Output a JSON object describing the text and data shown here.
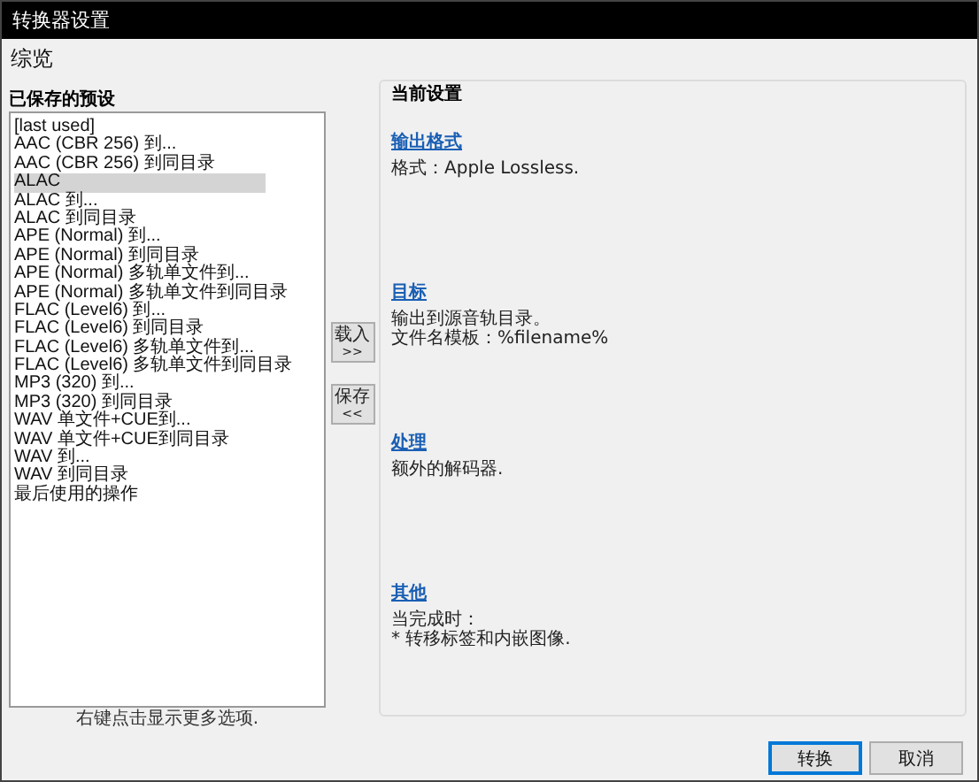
{
  "window": {
    "title": "转换器设置"
  },
  "heading": "综览",
  "presets": {
    "label": "已保存的预设",
    "hint": "右键点击显示更多选项.",
    "items": [
      {
        "label": "[last used]",
        "selected": false
      },
      {
        "label": "AAC (CBR 256) 到...",
        "selected": false
      },
      {
        "label": "AAC (CBR 256) 到同目录",
        "selected": false
      },
      {
        "label": "ALAC",
        "selected": true
      },
      {
        "label": "ALAC 到...",
        "selected": false
      },
      {
        "label": "ALAC 到同目录",
        "selected": false
      },
      {
        "label": "APE (Normal) 到...",
        "selected": false
      },
      {
        "label": "APE (Normal) 到同目录",
        "selected": false
      },
      {
        "label": "APE (Normal) 多轨单文件到...",
        "selected": false
      },
      {
        "label": "APE (Normal) 多轨单文件到同目录",
        "selected": false
      },
      {
        "label": "FLAC (Level6) 到...",
        "selected": false
      },
      {
        "label": "FLAC (Level6) 到同目录",
        "selected": false
      },
      {
        "label": "FLAC (Level6) 多轨单文件到...",
        "selected": false
      },
      {
        "label": "FLAC (Level6) 多轨单文件到同目录",
        "selected": false
      },
      {
        "label": "MP3 (320) 到...",
        "selected": false
      },
      {
        "label": "MP3 (320) 到同目录",
        "selected": false
      },
      {
        "label": "WAV 单文件+CUE到...",
        "selected": false
      },
      {
        "label": "WAV 单文件+CUE到同目录",
        "selected": false
      },
      {
        "label": "WAV 到...",
        "selected": false
      },
      {
        "label": "WAV 到同目录",
        "selected": false
      },
      {
        "label": "最后使用的操作",
        "selected": false
      }
    ]
  },
  "transfer_buttons": [
    {
      "label": "载入",
      "arrow": ">>"
    },
    {
      "label": "保存",
      "arrow": "<<"
    }
  ],
  "current_settings": {
    "title": "当前设置",
    "sections": [
      {
        "link": "输出格式",
        "lines": [
          "格式：Apple Lossless."
        ]
      },
      {
        "link": "目标",
        "lines": [
          "输出到源音轨目录。",
          "文件名模板：%filename%"
        ]
      },
      {
        "link": "处理",
        "lines": [
          "额外的解码器."
        ]
      },
      {
        "link": "其他",
        "lines": [
          "当完成时：",
          "* 转移标签和内嵌图像."
        ]
      }
    ]
  },
  "buttons": [
    {
      "label": "转换",
      "focused": true
    },
    {
      "label": "取消",
      "focused": false
    }
  ]
}
